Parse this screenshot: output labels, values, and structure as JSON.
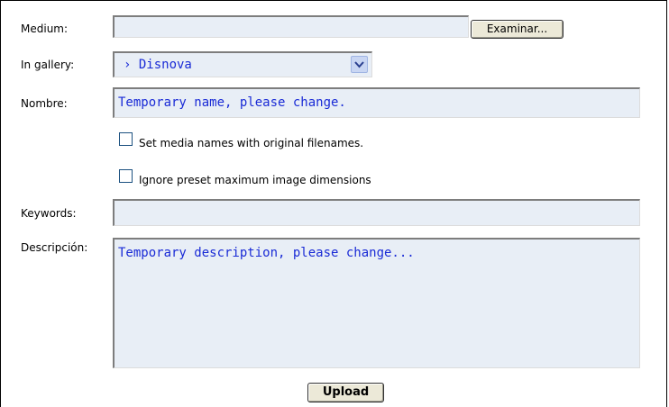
{
  "form": {
    "medium_label": "Medium:",
    "medium_value": "",
    "browse_button": "Examinar...",
    "gallery_label": "In gallery:",
    "gallery_selected": "› Disnova",
    "name_label": "Nombre:",
    "name_value": "Temporary name, please change.",
    "checkbox_original_names": "Set media names with original filenames.",
    "checkbox_ignore_dimensions": "Ignore preset maximum image dimensions",
    "keywords_label": "Keywords:",
    "keywords_value": "",
    "description_label": "Descripción:",
    "description_value": "Temporary description, please change...",
    "upload_button": "Upload"
  },
  "icons": {
    "select_arrow": "chevron-down-icon"
  },
  "colors": {
    "field_bg": "#e8eef6",
    "field_text": "#1a2bd6",
    "button_bg": "#ece9d8"
  }
}
